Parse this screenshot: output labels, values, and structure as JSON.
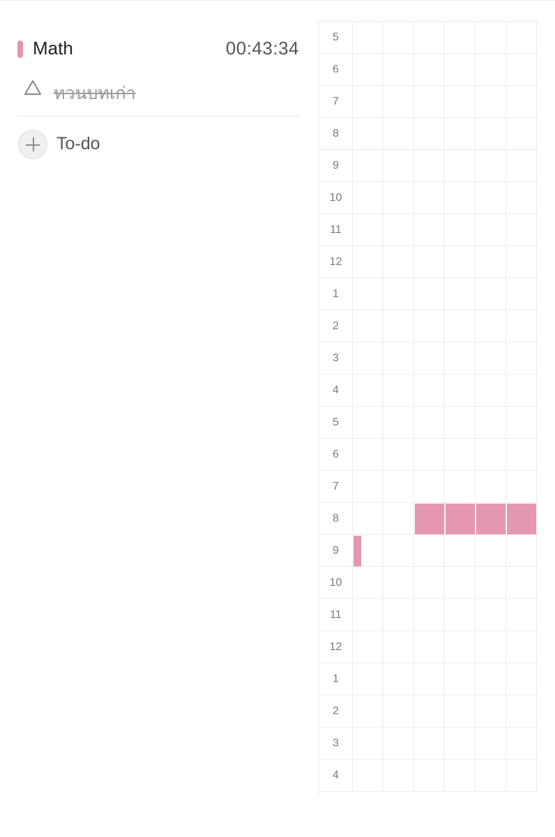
{
  "subject": {
    "name": "Math",
    "timer": "00:43:34",
    "color": "#e596b0"
  },
  "task": {
    "icon": "triangle-outline-icon",
    "label": "ทวนบทเก่า",
    "completed": true
  },
  "add_todo": {
    "icon": "plus-icon",
    "label": "To-do"
  },
  "timetable": {
    "accent_color": "#e596b0",
    "columns_per_hour": 6,
    "hours": [
      "5",
      "6",
      "7",
      "8",
      "9",
      "10",
      "11",
      "12",
      "1",
      "2",
      "3",
      "4",
      "5",
      "6",
      "7",
      "8",
      "9",
      "10",
      "11",
      "12",
      "1",
      "2",
      "3",
      "4"
    ],
    "filled": [
      {
        "row": 15,
        "start": 2,
        "end": 6
      },
      {
        "row": 16,
        "start": 0,
        "end": 0.3
      }
    ]
  }
}
